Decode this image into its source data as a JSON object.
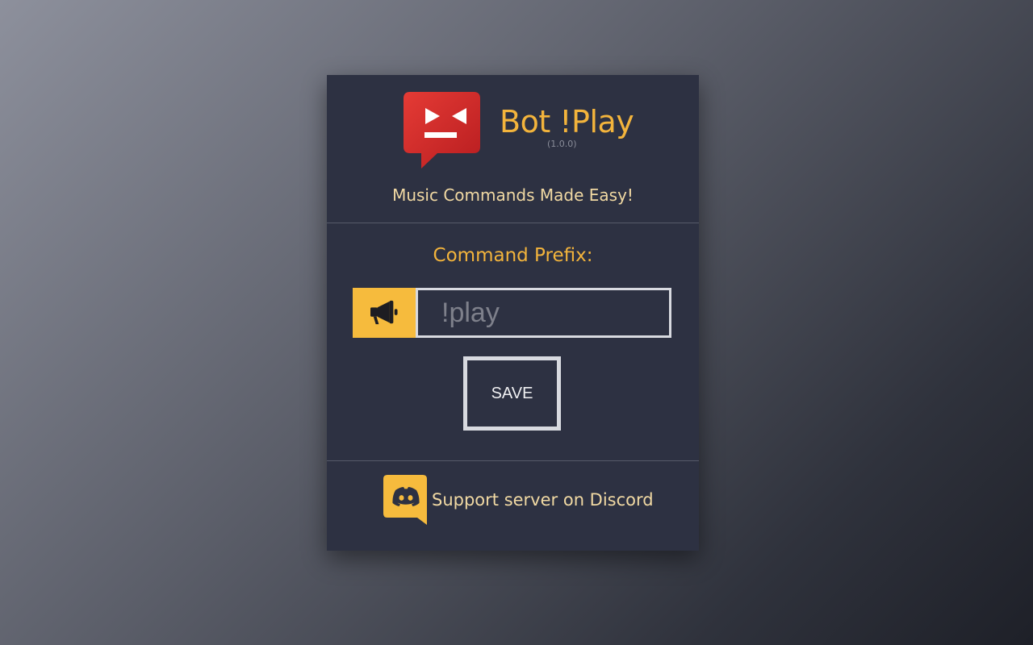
{
  "app": {
    "title": "Bot !Play",
    "version": "(1.0.0)",
    "tagline": "Music Commands Made Easy!"
  },
  "settings": {
    "prefix_label": "Command Prefix:",
    "prefix_placeholder": "!play",
    "prefix_value": "",
    "save_label": "SAVE"
  },
  "footer": {
    "support_text": "Support server on Discord"
  },
  "icons": {
    "logo": "robot-speech-bubble-icon",
    "prefix": "megaphone-icon",
    "support": "discord-icon"
  },
  "colors": {
    "accent": "#f3b43c",
    "card_background": "#2d3142",
    "logo_red": "#d42a2a",
    "text_light": "#f1d9a3"
  }
}
